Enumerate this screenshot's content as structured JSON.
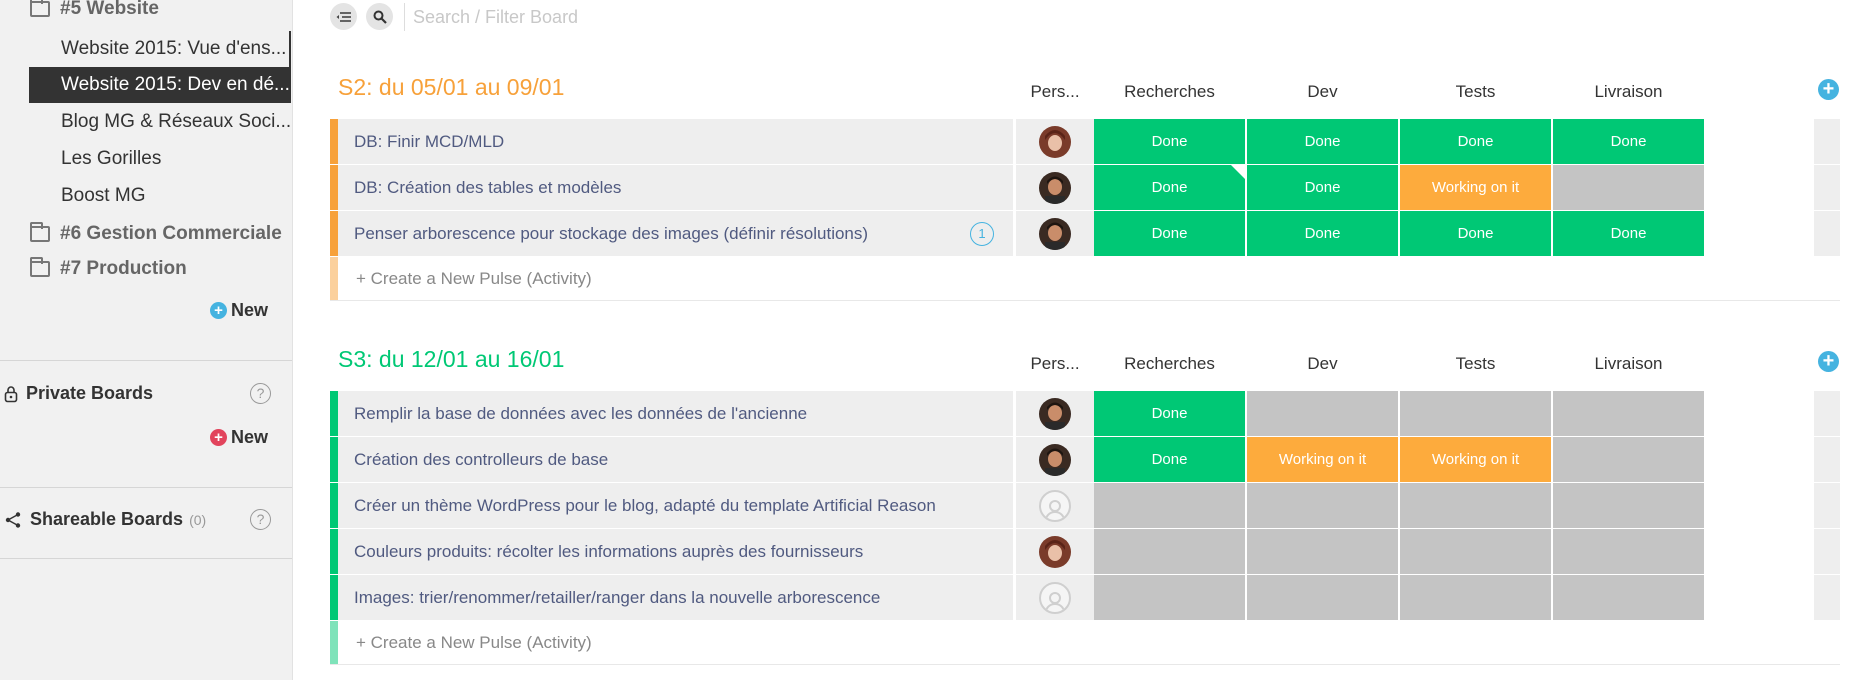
{
  "colors": {
    "done": "#00c875",
    "working": "#fdab3d",
    "empty": "#c4c4c4",
    "group_s2": "#f7a13a",
    "group_s3": "#00c875",
    "new_blue": "#45b3e0",
    "new_red": "#e2445c"
  },
  "sidebar": {
    "folder_website": "#5 Website",
    "boards": [
      "Website 2015: Vue d'ens...",
      "Website 2015: Dev en dé...",
      "Blog MG & Réseaux Soci...",
      "Les Gorilles",
      "Boost MG"
    ],
    "folder_commercial": "#6 Gestion Commerciale",
    "folder_production": "#7 Production",
    "new_label": "New",
    "private_title": "Private Boards",
    "private_new": "New",
    "shareable_title": "Shareable Boards",
    "shareable_count": "(0)",
    "help": "?"
  },
  "toolbar": {
    "search_placeholder": "Search / Filter Board"
  },
  "columns": [
    "Pers...",
    "Recherches",
    "Dev",
    "Tests",
    "Livraison"
  ],
  "new_pulse": "+ Create a New Pulse (Activity)",
  "groups": [
    {
      "title": "S2: du 05/01 au 09/01",
      "rows": [
        {
          "name": "DB: Finir MCD/MLD",
          "avatar": "woman",
          "statuses": [
            "Done",
            "Done",
            "Done",
            "Done"
          ]
        },
        {
          "name": "DB: Création des tables et modèles",
          "avatar": "man",
          "statuses": [
            "Done",
            "Done",
            "Working on it",
            ""
          ]
        },
        {
          "name": "Penser arborescence pour stockage des images (définir résolutions)",
          "avatar": "man",
          "updates": "1",
          "statuses": [
            "Done",
            "Done",
            "Done",
            "Done"
          ]
        }
      ]
    },
    {
      "title": "S3: du 12/01 au 16/01",
      "rows": [
        {
          "name": "Remplir la base de données avec les données de l'ancienne",
          "avatar": "man",
          "statuses": [
            "Done",
            "",
            "",
            ""
          ]
        },
        {
          "name": "Création des controlleurs de base",
          "avatar": "man",
          "statuses": [
            "Done",
            "Working on it",
            "Working on it",
            ""
          ]
        },
        {
          "name": "Créer un thème WordPress pour le blog, adapté du template Artificial Reason",
          "avatar": "empty",
          "statuses": [
            "",
            "",
            "",
            ""
          ]
        },
        {
          "name": "Couleurs produits: récolter les informations auprès des fournisseurs",
          "avatar": "woman",
          "statuses": [
            "",
            "",
            "",
            ""
          ]
        },
        {
          "name": "Images: trier/renommer/retailler/ranger dans la nouvelle arborescence",
          "avatar": "empty",
          "statuses": [
            "",
            "",
            "",
            ""
          ]
        }
      ]
    }
  ]
}
